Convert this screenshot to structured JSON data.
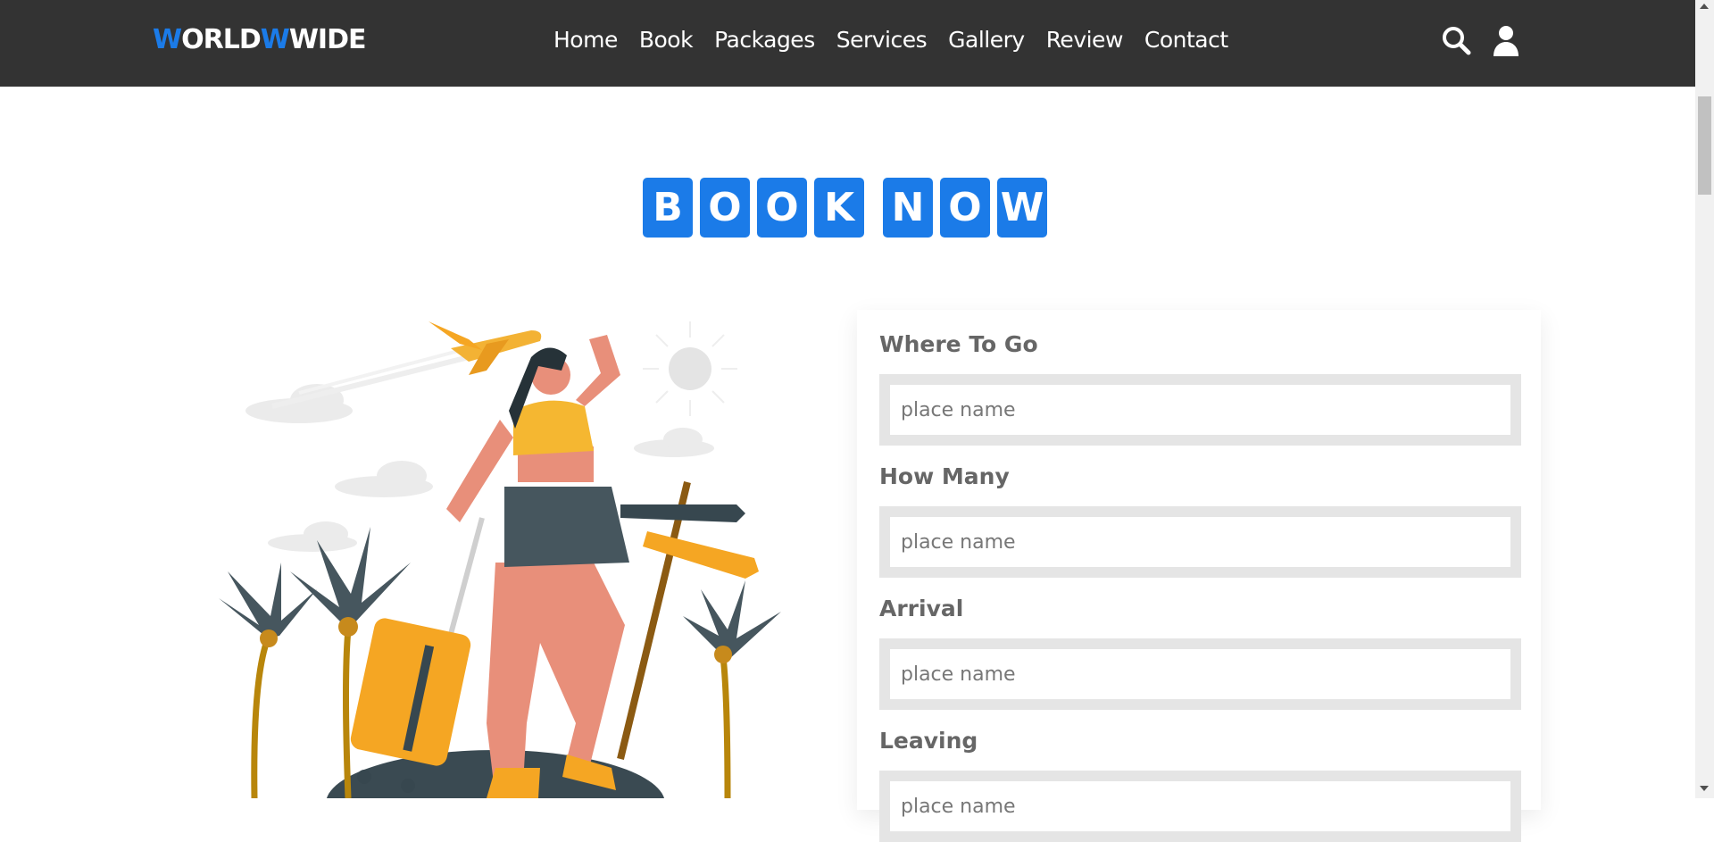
{
  "header": {
    "logo": {
      "part1": "W",
      "part2": "ORLD",
      "part3": "W",
      "part4": "WIDE"
    },
    "nav": [
      "Home",
      "Book",
      "Packages",
      "Services",
      "Gallery",
      "Review",
      "Contact"
    ],
    "icons": [
      "search-icon",
      "user-icon"
    ]
  },
  "heading": {
    "letters": [
      "B",
      "O",
      "O",
      "K",
      " ",
      "N",
      "O",
      "W"
    ]
  },
  "form": {
    "fields": [
      {
        "label": "Where To Go",
        "placeholder": "place name"
      },
      {
        "label": "How Many",
        "placeholder": "place name"
      },
      {
        "label": "Arrival",
        "placeholder": "place name"
      },
      {
        "label": "Leaving",
        "placeholder": "place name"
      }
    ]
  },
  "colors": {
    "accent": "#1b7be8",
    "header_bg": "#333333",
    "label": "#666666"
  }
}
